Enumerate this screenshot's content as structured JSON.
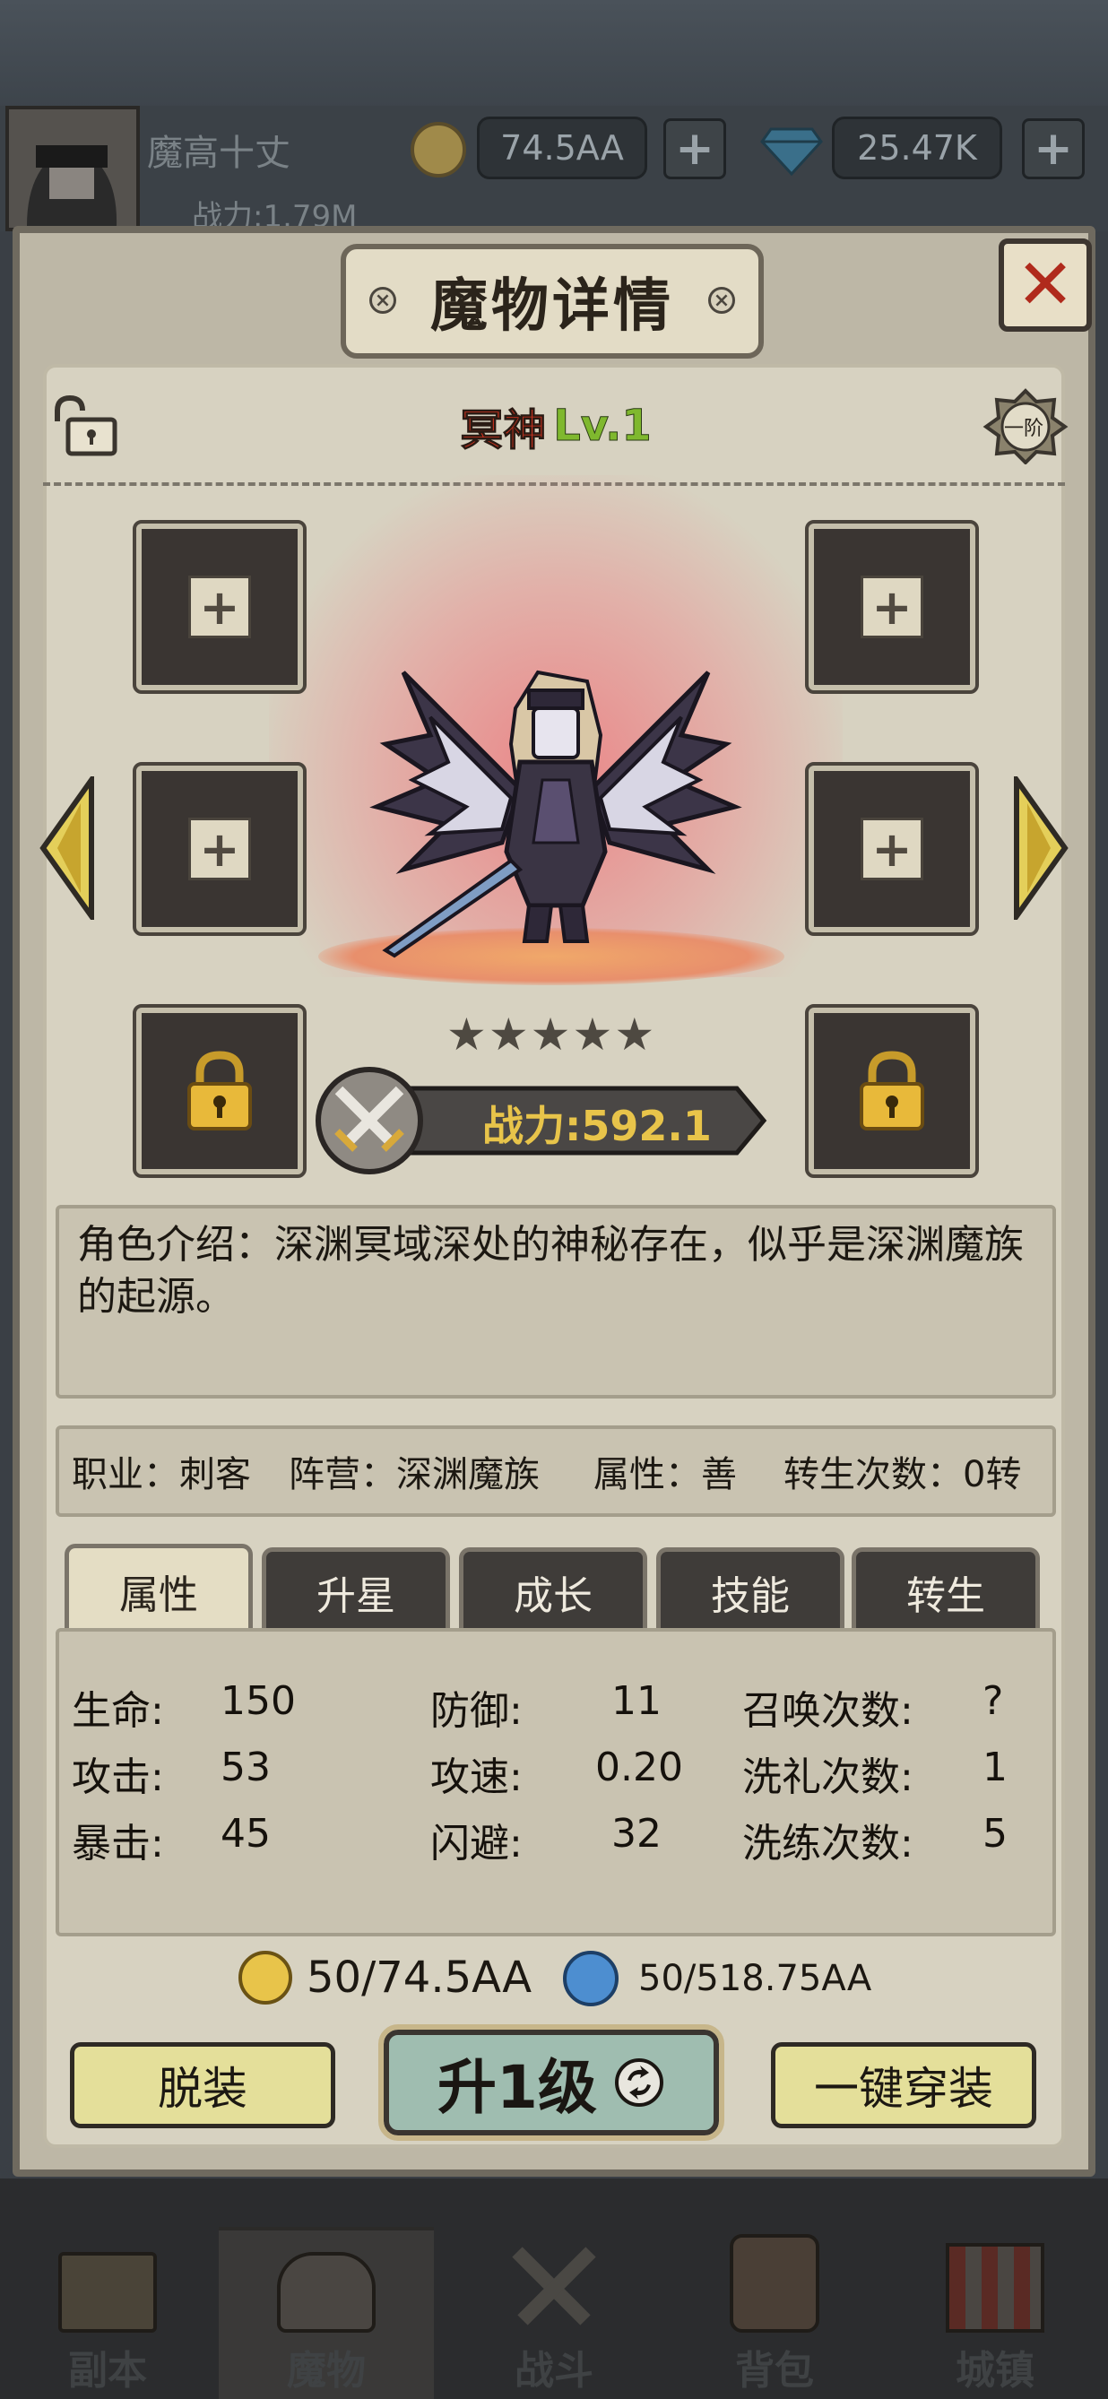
{
  "topbar": {
    "player_name": "魔高十丈",
    "combat_power": "战力:1.79M",
    "gold": "74.5AA",
    "gems": "25.47K",
    "add": "+"
  },
  "panel": {
    "title": "魔物详情",
    "close": "✕"
  },
  "monster": {
    "name": "冥神",
    "level": "Lv.1",
    "tier": "一阶",
    "power": "战力:592.1",
    "stars": 5,
    "description": "角色介绍：深渊冥域深处的神秘存在，似乎是深渊魔族的起源。"
  },
  "info": {
    "job": "职业：刺客",
    "camp": "阵营：深渊魔族",
    "attr": "属性：善",
    "rebirth": "转生次数：0转"
  },
  "tabs": [
    "属性",
    "升星",
    "成长",
    "技能",
    "转生"
  ],
  "stats": {
    "hp_label": "生命:",
    "hp": "150",
    "atk_label": "攻击:",
    "atk": "53",
    "crit_label": "暴击:",
    "crit": "45",
    "def_label": "防御:",
    "def": "11",
    "spd_label": "攻速:",
    "spd": "0.20",
    "eva_label": "闪避:",
    "eva": "32",
    "summon_label": "召唤次数:",
    "summon": "?",
    "baptism_label": "洗礼次数:",
    "baptism": "1",
    "refine_label": "洗练次数:",
    "refine": "5"
  },
  "costs": {
    "gold": "50/74.5AA",
    "essence": "50/518.75AA"
  },
  "actions": {
    "unequip": "脱装",
    "level_up": "升1级",
    "equip_all": "一键穿装"
  },
  "nav": [
    "副本",
    "魔物",
    "战斗",
    "背包",
    "城镇"
  ],
  "colors": {
    "panel": "#d7d2c1",
    "accent_red": "#d2331f",
    "accent_green": "#7fb82e",
    "button_yellow": "#e4df9a",
    "button_teal": "#9fbdb0"
  }
}
